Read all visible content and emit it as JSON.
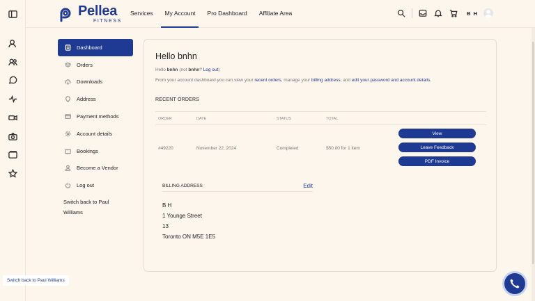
{
  "header": {
    "brand_name": "Pellea",
    "brand_sub": "FITNESS",
    "nav": [
      "Services",
      "My Account",
      "Pro Dashboard",
      "Affiliate Area"
    ],
    "initials": "B H"
  },
  "rail_icons": [
    "sidebar-toggle-icon",
    "user-icon",
    "users-icon",
    "chat-icon",
    "activity-icon",
    "video-icon",
    "camera-icon",
    "folder-icon",
    "star-icon"
  ],
  "account_nav": {
    "items": [
      "Dashboard",
      "Orders",
      "Downloads",
      "Address",
      "Payment methods",
      "Account details",
      "Bookings",
      "Become a Vendor",
      "Log out"
    ],
    "switch_back": "Switch back to Paul Williams"
  },
  "main": {
    "title": "Hello bnhn",
    "hello_prefix": "Hello ",
    "user": "bnhn",
    "not_text": " (not ",
    "not_user": "bnhn",
    "logout_q": "? ",
    "logout": "Log out",
    "close_paren": ")",
    "desc_1": "From your account dashboard you can view your ",
    "link_orders": "recent orders",
    "desc_2": ", manage your ",
    "link_billing": "billing address",
    "desc_3": ", and ",
    "link_password": "edit your password and account details",
    "desc_4": ".",
    "recent_orders": "RECENT ORDERS",
    "columns": [
      "ORDER",
      "DATE",
      "STATUS",
      "TOTAL"
    ],
    "order": {
      "number": "#49220",
      "date": "November 22, 2024",
      "status": "Completed",
      "total": "$50.00 for 1 item"
    },
    "buttons": [
      "View",
      "Leave Feedback",
      "PDF Invoice"
    ],
    "billing_title": "BILLING ADDRESS",
    "edit": "Edit",
    "address": [
      "B H",
      "1 Younge Street",
      "13",
      "Toronto ON M5E 1E5"
    ]
  },
  "floating": {
    "switch_back": "Switch back to Paul Williams"
  },
  "colors": {
    "brand": "#1f3a93",
    "background": "#fdf6ec"
  }
}
